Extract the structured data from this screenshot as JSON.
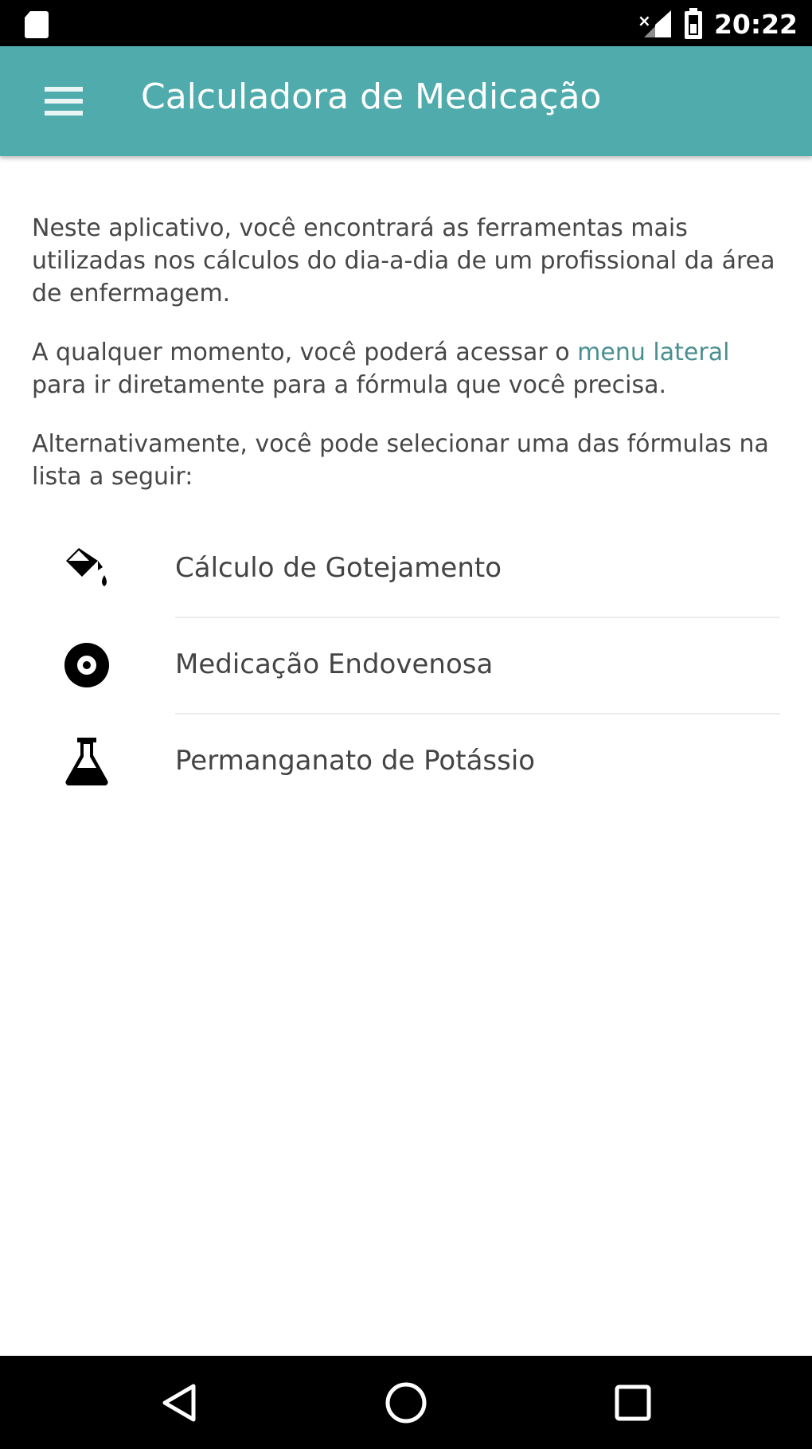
{
  "status_bar": {
    "time": "20:22",
    "icons": [
      "sd-card-icon",
      "signal-icon",
      "battery-icon"
    ]
  },
  "app_bar": {
    "title": "Calculadora de Medicação",
    "menu_icon": "hamburger-menu-icon",
    "color": "#4fabac"
  },
  "intro": {
    "paragraph_1": "Neste aplicativo, você encontrará as ferramentas mais utilizadas nos cálculos do dia-a-dia de um profissional da área de enfermagem.",
    "paragraph_2_before": "A qualquer momento, você poderá acessar o ",
    "paragraph_2_link": "menu lateral",
    "paragraph_2_after": " para ir diretamente para a fórmula que você precisa.",
    "paragraph_3": "Alternativamente, você pode selecionar uma das fórmulas na lista a seguir:",
    "link_color": "#4a8f90"
  },
  "formulas": [
    {
      "label": "Cálculo de Gotejamento",
      "icon": "paint-bucket-drip-icon"
    },
    {
      "label": "Medicação Endovenosa",
      "icon": "disc-icon"
    },
    {
      "label": "Permanganato de Potássio",
      "icon": "flask-icon"
    }
  ],
  "nav_bar": {
    "buttons": [
      "back-triangle-icon",
      "home-circle-icon",
      "recents-square-icon"
    ]
  }
}
